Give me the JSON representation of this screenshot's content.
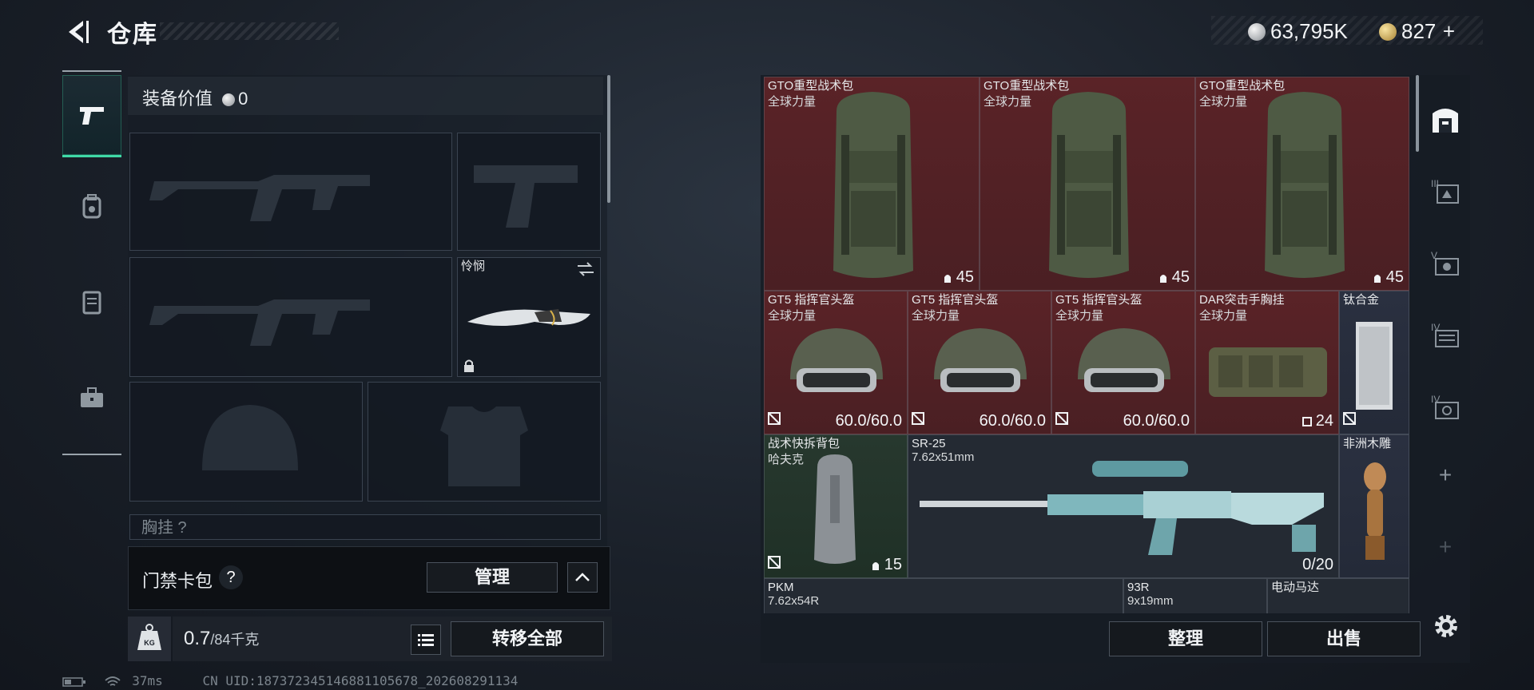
{
  "header": {
    "title": "仓库",
    "currency_silver": "63,795K",
    "currency_gold": "827",
    "currency_gold_add": "+"
  },
  "left_tabs": [
    {
      "icon": "pistol-icon",
      "active": true
    },
    {
      "icon": "backpack-icon",
      "active": false
    },
    {
      "icon": "vest-icon",
      "active": false
    },
    {
      "icon": "toolbox-icon",
      "active": false
    }
  ],
  "equipment": {
    "value_label": "装备价值",
    "value": "0",
    "knife_name": "怜悯",
    "chest_rig_label": "胸挂 ?"
  },
  "gate_card": {
    "label": "门禁卡包",
    "help": "?",
    "manage": "管理"
  },
  "weight": {
    "icon_label": "KG",
    "current": "0.7",
    "max": "/84千克",
    "transfer_all": "转移全部"
  },
  "status_bar": {
    "ping": "37ms",
    "uid": "CN UID:187372345146881105678_202608291134"
  },
  "storage": {
    "items": [
      {
        "name": "GTO重型战术包",
        "sub": "全球力量",
        "value": "45",
        "color": "red",
        "type": "backpack"
      },
      {
        "name": "GTO重型战术包",
        "sub": "全球力量",
        "value": "45",
        "color": "red",
        "type": "backpack"
      },
      {
        "name": "GTO重型战术包",
        "sub": "全球力量",
        "value": "45",
        "color": "red",
        "type": "backpack"
      },
      {
        "name": "GT5 指挥官头盔",
        "sub": "全球力量",
        "value": "60.0/60.0",
        "color": "red",
        "type": "helmet"
      },
      {
        "name": "GT5 指挥官头盔",
        "sub": "全球力量",
        "value": "60.0/60.0",
        "color": "red",
        "type": "helmet"
      },
      {
        "name": "GT5 指挥官头盔",
        "sub": "全球力量",
        "value": "60.0/60.0",
        "color": "red",
        "type": "helmet"
      },
      {
        "name": "DAR突击手胸挂",
        "sub": "全球力量",
        "value": "24",
        "color": "red",
        "type": "rig"
      },
      {
        "name": "钛合金",
        "sub": "",
        "value": "",
        "color": "blue",
        "type": "ingot"
      },
      {
        "name": "战术快拆背包",
        "sub": "哈夫克",
        "value": "15",
        "color": "green",
        "type": "bag"
      },
      {
        "name": "SR-25",
        "sub": "7.62x51mm",
        "value": "0/20",
        "color": "gray",
        "type": "rifle"
      },
      {
        "name": "非洲木雕",
        "sub": "",
        "value": "",
        "color": "blue",
        "type": "statue"
      },
      {
        "name": "PKM",
        "sub": "7.62x54R",
        "value": "",
        "color": "gray",
        "type": "lmg"
      },
      {
        "name": "93R",
        "sub": "9x19mm",
        "value": "",
        "color": "gray",
        "type": "pistol"
      },
      {
        "name": "电动马达",
        "sub": "",
        "value": "",
        "color": "gray",
        "type": "motor"
      }
    ],
    "sort": "整理",
    "sell": "出售"
  },
  "right_rail": [
    {
      "icon": "vault-icon",
      "label": ""
    },
    {
      "icon": "storage-tier-3-icon",
      "label": "III"
    },
    {
      "icon": "storage-tier-5-icon",
      "label": "V"
    },
    {
      "icon": "storage-tier-4a-icon",
      "label": "IV"
    },
    {
      "icon": "storage-tier-4b-icon",
      "label": "IV"
    },
    {
      "icon": "add-icon",
      "label": "+"
    },
    {
      "icon": "add-icon-dim",
      "label": "+"
    }
  ]
}
